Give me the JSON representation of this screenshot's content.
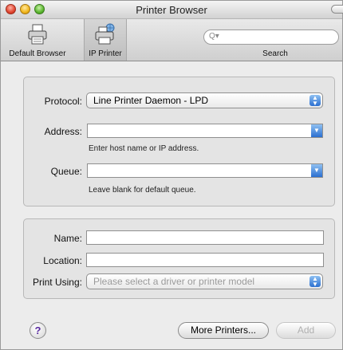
{
  "window": {
    "title": "Printer Browser"
  },
  "toolbar": {
    "items": [
      {
        "label": "Default Browser",
        "icon": "printer-icon"
      },
      {
        "label": "IP Printer",
        "icon": "network-printer-icon"
      }
    ],
    "search": {
      "label": "Search",
      "placeholder": "",
      "icon": "search-icon"
    }
  },
  "protocol": {
    "label": "Protocol:",
    "value": "Line Printer Daemon - LPD"
  },
  "address": {
    "label": "Address:",
    "value": "",
    "hint": "Enter host name or IP address."
  },
  "queue": {
    "label": "Queue:",
    "value": "",
    "hint": "Leave blank for default queue."
  },
  "name": {
    "label": "Name:",
    "value": ""
  },
  "location": {
    "label": "Location:",
    "value": ""
  },
  "print_using": {
    "label": "Print Using:",
    "value": "Please select a driver or printer model"
  },
  "buttons": {
    "help": "?",
    "more_printers": "More Printers...",
    "add": "Add"
  },
  "colors": {
    "accent": "#2b6fd0",
    "window_bg": "#ececec"
  }
}
